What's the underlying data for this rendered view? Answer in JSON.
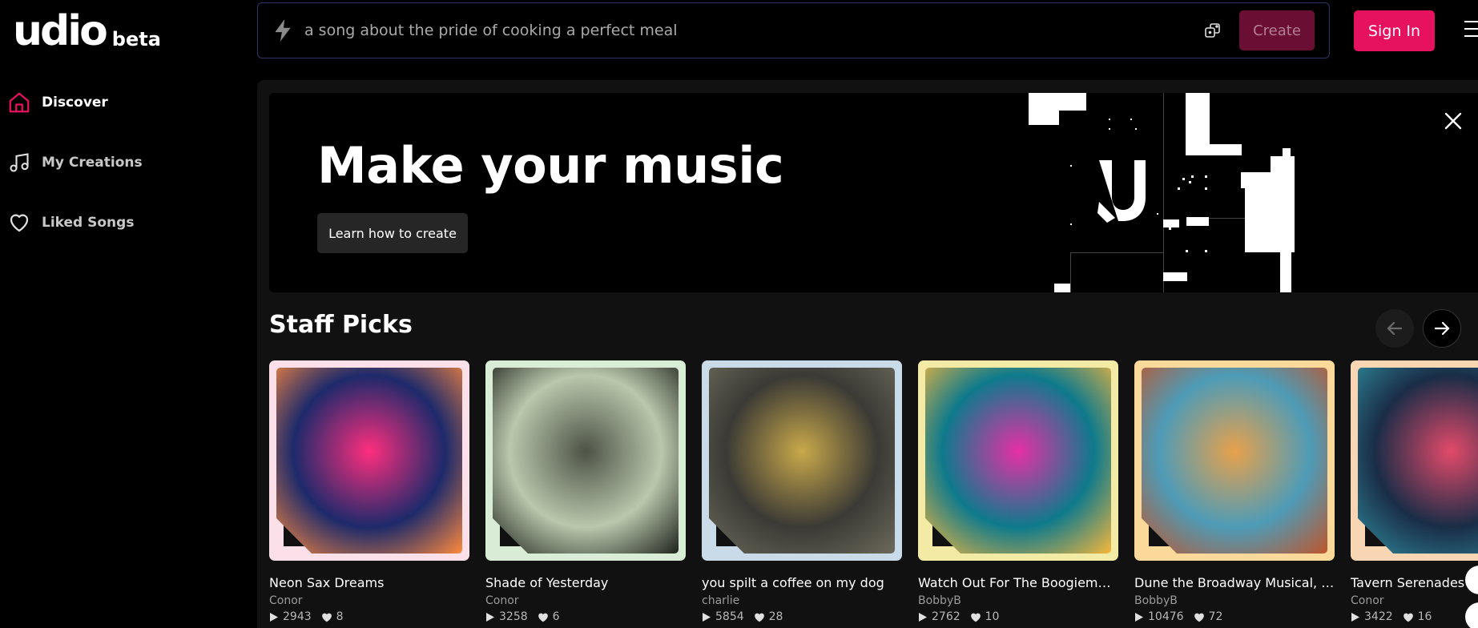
{
  "logo": {
    "main": "udio",
    "tag": "beta"
  },
  "sidebar": {
    "items": [
      {
        "label": "Discover",
        "icon": "home-icon",
        "active": true
      },
      {
        "label": "My Creations",
        "icon": "music-note-icon",
        "active": false
      },
      {
        "label": "Liked Songs",
        "icon": "heart-icon",
        "active": false
      }
    ]
  },
  "prompt": {
    "placeholder": "a song about the pride of cooking a perfect meal",
    "create_label": "Create"
  },
  "header": {
    "signin_label": "Sign In"
  },
  "hero": {
    "title": "Make your music",
    "button_label": "Learn how to create"
  },
  "staff_picks": {
    "title": "Staff Picks",
    "cards": [
      {
        "title": "Neon Sax Dreams",
        "author": "Conor",
        "plays": "2943",
        "likes": "8",
        "frame": "#fbe0ea",
        "colors": [
          "#1d2a6b",
          "#ff2e7e",
          "#ff8a3d"
        ]
      },
      {
        "title": "Shade of Yesterday",
        "author": "Conor",
        "plays": "3258",
        "likes": "6",
        "frame": "#d8ecd6",
        "colors": [
          "#b9c7ac",
          "#4d5346",
          "#1e221c"
        ]
      },
      {
        "title": "you spilt a coffee on my dog",
        "author": "charlie",
        "plays": "5854",
        "likes": "28",
        "frame": "#c9dbe8",
        "colors": [
          "#3b3a35",
          "#c9a94b",
          "#6c6a5b"
        ]
      },
      {
        "title": "Watch Out For The Boogieman, ...",
        "author": "BobbyB",
        "plays": "2762",
        "likes": "10",
        "frame": "#f3eaa6",
        "colors": [
          "#0e7a8c",
          "#e62fa6",
          "#f6b73c"
        ]
      },
      {
        "title": "Dune the Broadway Musical, Sh...",
        "author": "BobbyB",
        "plays": "10476",
        "likes": "72",
        "frame": "#fbd99a",
        "colors": [
          "#4d9bb7",
          "#e8a14b",
          "#c0552b"
        ]
      },
      {
        "title": "Tavern Serenades",
        "author": "Conor",
        "plays": "3422",
        "likes": "16",
        "frame": "#f9d6b3",
        "colors": [
          "#1a2d47",
          "#e34a6a",
          "#2f8c9e"
        ]
      }
    ]
  },
  "colors": {
    "accent": "#e6115f",
    "create_disabled": "#6b0e33"
  }
}
